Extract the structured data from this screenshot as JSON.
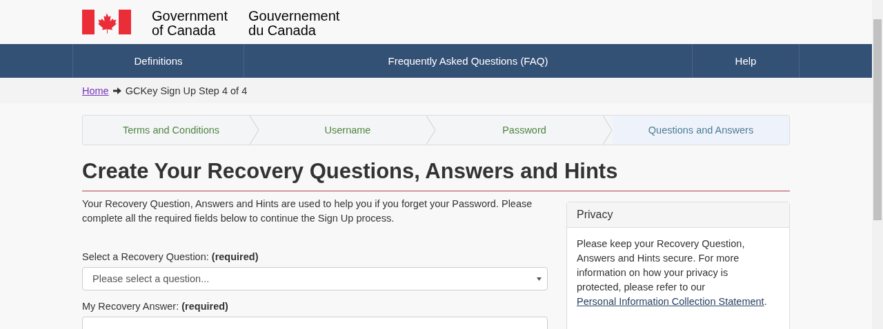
{
  "header": {
    "signature_en": [
      "Government",
      "of Canada"
    ],
    "signature_fr": [
      "Gouvernement",
      "du Canada"
    ]
  },
  "nav": [
    {
      "label": "Definitions"
    },
    {
      "label": "Frequently Asked Questions (FAQ)"
    },
    {
      "label": "Help"
    }
  ],
  "breadcrumb": {
    "home": "Home",
    "current": "GCKey Sign Up Step 4 of 4"
  },
  "steps": [
    {
      "label": "Terms and Conditions",
      "selected": false
    },
    {
      "label": "Username",
      "selected": false
    },
    {
      "label": "Password",
      "selected": false
    },
    {
      "label": "Questions and Answers",
      "selected": true
    }
  ],
  "title": "Create Your Recovery Questions, Answers and Hints",
  "intro": "Your Recovery Question, Answers and Hints are used to help you if you forget your Password. Please complete all the required fields below to continue the Sign Up process.",
  "fields": [
    {
      "kind": "select",
      "label": "Select a Recovery Question: **(required)**",
      "placeholder": "Please select a question..."
    },
    {
      "kind": "text",
      "label": "My Recovery Answer: **(required)**"
    }
  ],
  "privacy": {
    "title": "Privacy",
    "text": "Please keep your Recovery Question, Answers and Hints secure. For more information on how your privacy is protected, please refer to our",
    "link": "Personal Information Collection Statement",
    "after": "."
  }
}
